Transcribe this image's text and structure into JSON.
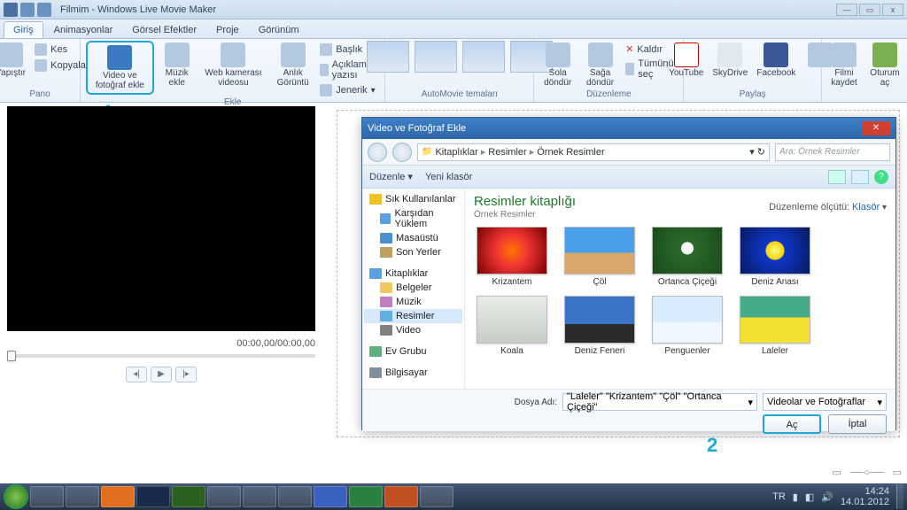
{
  "title": "Filmim - Windows Live Movie Maker",
  "winbtns": {
    "min": "—",
    "max": "▭",
    "close": "x"
  },
  "tabs": [
    "Giriş",
    "Animasyonlar",
    "Görsel Efektler",
    "Proje",
    "Görünüm"
  ],
  "ribbon": {
    "pano": {
      "label": "Pano",
      "paste": "Yapıştır",
      "cut": "Kes",
      "copy": "Kopyala"
    },
    "ekle": {
      "label": "Ekle",
      "add": "Video ve fotoğraf ekle",
      "music": "Müzik ekle",
      "webcam": "Web kamerası videosu",
      "snapshot": "Anlık Görüntü",
      "titlebtn": "Başlık",
      "caption": "Açıklama yazısı",
      "credits": "Jenerik"
    },
    "themes": {
      "label": "AutoMovie temaları"
    },
    "edit": {
      "label": "Düzenleme",
      "rotl": "Sola döndür",
      "rotr": "Sağa döndür",
      "remove": "Kaldır",
      "selectall": "Tümünü seç"
    },
    "share": {
      "label": "Paylaş",
      "youtube": "YouTube",
      "skydrive": "SkyDrive",
      "facebook": "Facebook",
      "more": "..."
    },
    "save": {
      "save": "Filmi kaydet",
      "signin": "Oturum aç"
    }
  },
  "callout1": "1",
  "callout2": "2",
  "preview": {
    "time": "00:00,00/00:00,00",
    "prev": "◂|",
    "play": "▶",
    "next": "|▸"
  },
  "dialog": {
    "title": "Video ve Fotoğraf Ekle",
    "crumbs": [
      "Kitaplıklar",
      "Resimler",
      "Örnek Resimler"
    ],
    "search_ph": "Ara: Örnek Resimler",
    "toolbar": {
      "organize": "Düzenle",
      "newfolder": "Yeni klasör"
    },
    "tree": {
      "fav": "Sık Kullanılanlar",
      "dl": "Karşıdan Yüklem",
      "desk": "Masaüstü",
      "recent": "Son Yerler",
      "libs": "Kitaplıklar",
      "docs": "Belgeler",
      "music": "Müzik",
      "pics": "Resimler",
      "video": "Video",
      "home": "Ev Grubu",
      "pc": "Bilgisayar"
    },
    "lib": {
      "title": "Resimler kitaplığı",
      "sub": "Örnek Resimler",
      "sort": "Düzenleme ölçütü:",
      "sortval": "Klasör"
    },
    "thumbs": [
      {
        "l": "Krizantem"
      },
      {
        "l": "Çöl"
      },
      {
        "l": "Ortanca Çiçeği"
      },
      {
        "l": "Deniz Anası"
      },
      {
        "l": "Koala"
      },
      {
        "l": "Deniz Feneri"
      },
      {
        "l": "Penguenler"
      },
      {
        "l": "Laleler"
      }
    ],
    "filelabel": "Dosya Adı:",
    "filename": "\"Laleler\" \"Krizantem\" \"Çöl\" \"Ortanca Çiçeği\"",
    "filetype": "Videolar ve Fotoğraflar",
    "open": "Aç",
    "cancel": "İptal"
  },
  "tray": {
    "lang": "TR",
    "time": "14:24",
    "date": "14.01.2012"
  }
}
